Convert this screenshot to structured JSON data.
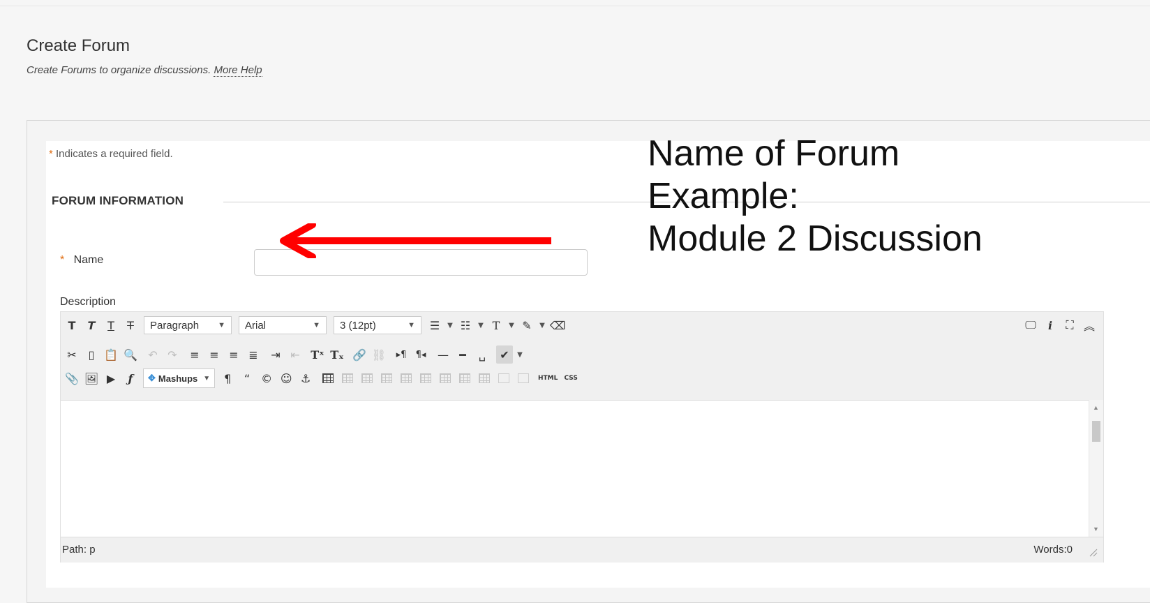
{
  "page": {
    "title": "Create Forum",
    "subtitle": "Create Forums to organize discussions.",
    "help_link": "More Help"
  },
  "form": {
    "required_star": "*",
    "required_note": "Indicates a required field.",
    "section_title": "FORUM INFORMATION",
    "name_label": "Name",
    "name_value": "",
    "description_label": "Description"
  },
  "annotation": {
    "line1": "Name of Forum",
    "line2": "Example:",
    "line3": "Module 2 Discussion",
    "arrow_color": "#ff0000"
  },
  "editor": {
    "toolbar_row1": {
      "bold": "T",
      "italic": "T",
      "underline": "T",
      "strike": "T",
      "paragraph": "Paragraph",
      "font": "Arial",
      "size": "3 (12pt)",
      "text_color": "T"
    },
    "toolbar_row3": {
      "mashups": "Mashups",
      "html": "HTML",
      "css": "CSS"
    },
    "status": {
      "path": "Path: p",
      "words": "Words:0"
    }
  },
  "colors": {
    "accent_star": "#e06a0c",
    "toolbar_bg": "#f0f0f0"
  }
}
